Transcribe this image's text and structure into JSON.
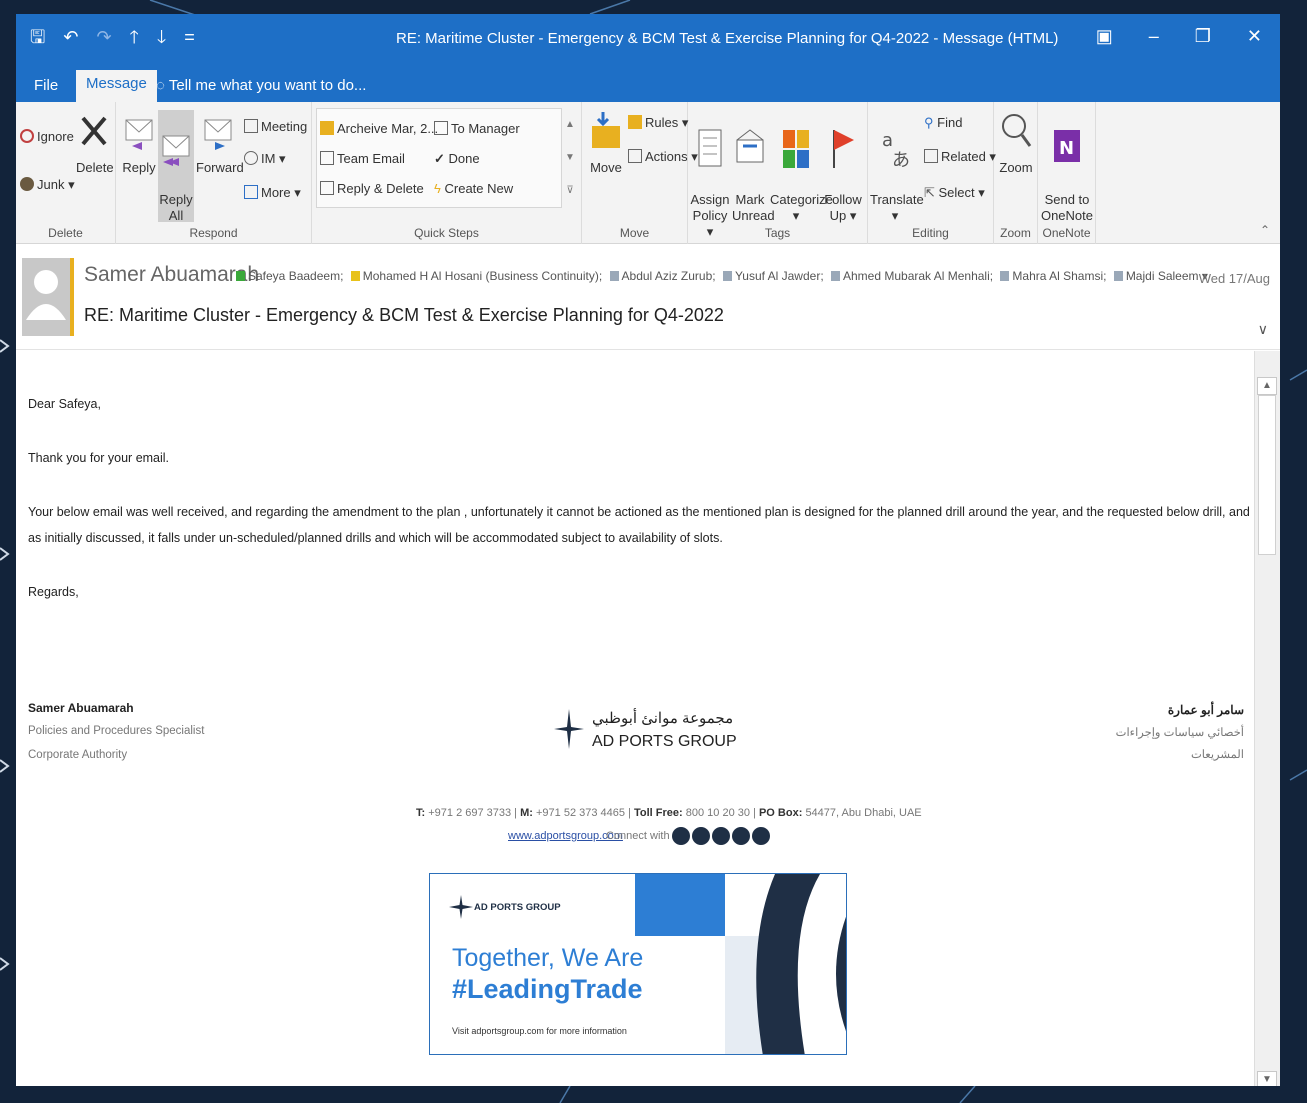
{
  "window": {
    "title": "RE: Maritime Cluster - Emergency & BCM Test & Exercise Planning for Q4-2022 - Message (HTML)",
    "controls": [
      "▣",
      "–",
      "❐",
      "✕"
    ]
  },
  "qat": [
    "🖫",
    "↶",
    "↷",
    "🡑",
    "🡓",
    "="
  ],
  "menu": {
    "file": "File",
    "message": "Message",
    "tell_me": "Tell me what you want to do..."
  },
  "ribbon": {
    "delete": {
      "ignore": "Ignore",
      "junk": "Junk ▾",
      "delete": "Delete",
      "label": "Delete"
    },
    "respond": {
      "reply": "Reply",
      "reply_all": "Reply\nAll",
      "forward": "Forward",
      "meeting": "Meeting",
      "im": "IM ▾",
      "more": "More ▾",
      "label": "Respond"
    },
    "quick_steps": {
      "archive": "Archeive Mar, 2...",
      "to_manager": "To Manager",
      "team_email": "Team Email",
      "done": "Done",
      "reply_delete": "Reply & Delete",
      "create_new": "Create New",
      "label": "Quick Steps"
    },
    "move": {
      "move": "Move",
      "rules": "Rules ▾",
      "actions": "Actions ▾",
      "label": "Move"
    },
    "tags": {
      "assign_policy": "Assign\nPolicy ▾",
      "mark_unread": "Mark\nUnread",
      "categorize": "Categorize\n▾",
      "follow_up": "Follow\nUp ▾",
      "label": "Tags"
    },
    "editing": {
      "translate": "Translate\n▾",
      "find": "Find",
      "related": "Related ▾",
      "select": "Select ▾",
      "label": "Editing"
    },
    "zoom": {
      "zoom": "Zoom",
      "label": "Zoom"
    },
    "onenote": {
      "send": "Send to\nOneNote",
      "label": "OneNote"
    }
  },
  "header": {
    "sender": "Samer Abuamarah",
    "recipients": [
      {
        "name": "Safeya Baadeem;",
        "color": "#3aa83a"
      },
      {
        "name": "Mohamed H Al Hosani (Business Continuity);",
        "color": "#e8c21a"
      },
      {
        "name": "Abdul Aziz Zurub;",
        "color": "#9aa8b8"
      },
      {
        "name": "Yusuf Al Jawder;",
        "color": "#9aa8b8"
      },
      {
        "name": "Ahmed Mubarak Al Menhali;",
        "color": "#9aa8b8"
      },
      {
        "name": "Mahra Al Shamsi;",
        "color": "#9aa8b8"
      },
      {
        "name": "Majdi Saleem ▾",
        "color": "#9aa8b8"
      }
    ],
    "date": "Wed 17/Aug",
    "subject": "RE: Maritime Cluster - Emergency & BCM Test & Exercise Planning for Q4-2022"
  },
  "body": {
    "greeting": "Dear Safeya,",
    "thanks": "Thank you for your email.",
    "main": "Your below email was well received, and regarding the amendment to the plan , unfortunately it cannot be actioned as the mentioned plan is designed for the planned drill around the year, and the requested below drill, and as initially discussed, it falls under un-scheduled/planned drills and which will be accommodated subject to availability of slots.",
    "regards": "Regards,"
  },
  "signature": {
    "name": "Samer Abuamarah",
    "title": "Policies and Procedures Specialist",
    "dept": "Corporate Authority",
    "ar_name": "سامر أبو عمارة",
    "ar_title": "أخصائي سياسات وإجراءات",
    "ar_dept": "المشريعات",
    "logo_ar": "مجموعة موانئ أبوظبي",
    "logo_en": "AD PORTS GROUP",
    "t_label": "T:",
    "t_val": "+971 2 697 3733 |",
    "m_label": "M:",
    "m_val": "+971 52 373 4465 |",
    "tf_label": "Toll Free:",
    "tf_val": "800 10 20 30 |",
    "po_label": "PO Box:",
    "po_val": "54477, Abu Dhabi, UAE",
    "web": "www.adportsgroup.com",
    "connect": "Connect with us"
  },
  "banner": {
    "brand": "AD PORTS GROUP",
    "line1": "Together, We Are",
    "line2": "#LeadingTrade",
    "visit": "Visit adportsgroup.com for more information"
  },
  "colors": {
    "titlebar": "#1e6fc6",
    "accent_blue": "#2d7ed4",
    "navy": "#1f2f45"
  }
}
